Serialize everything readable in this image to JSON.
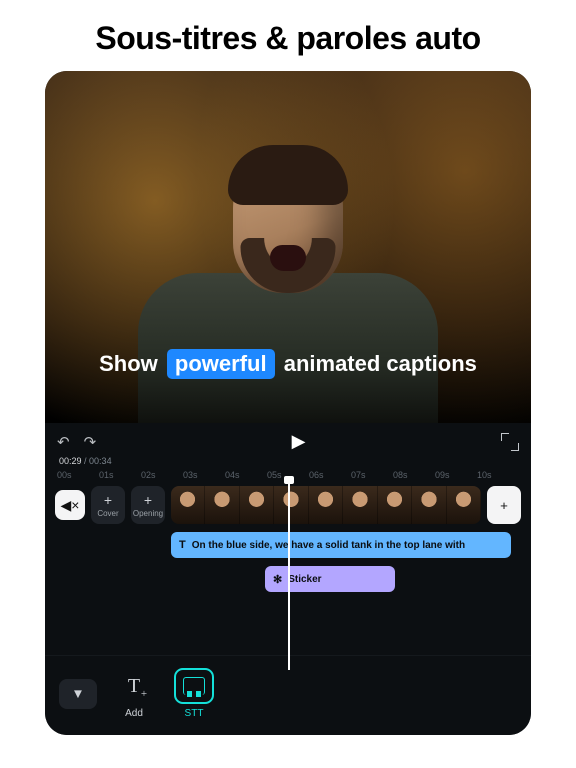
{
  "headline": "Sous-titres & paroles auto",
  "preview": {
    "caption_pre": "Show",
    "caption_hl": "powerful",
    "caption_post": "animated captions"
  },
  "transport": {
    "undo_glyph": "↶",
    "redo_glyph": "↷",
    "play_glyph": "▶",
    "time_current": "00:29",
    "time_total": "00:34"
  },
  "ruler": [
    "00s",
    "01s",
    "02s",
    "03s",
    "04s",
    "05s",
    "06s",
    "07s",
    "08s",
    "09s",
    "10s"
  ],
  "track": {
    "mute_glyph": "◀×",
    "cover_plus": "+",
    "cover_label": "Cover",
    "opening_plus": "+",
    "opening_label": "Opening",
    "add_plus": "+",
    "caption_layer_icon": "T",
    "caption_layer_text": "On the blue side,  we have a solid tank in the top lane with",
    "sticker_layer_icon": "✻",
    "sticker_layer_text": "Sticker"
  },
  "toolbar": {
    "chevron_glyph": "▼",
    "add_label": "Add",
    "stt_label": "STT"
  }
}
